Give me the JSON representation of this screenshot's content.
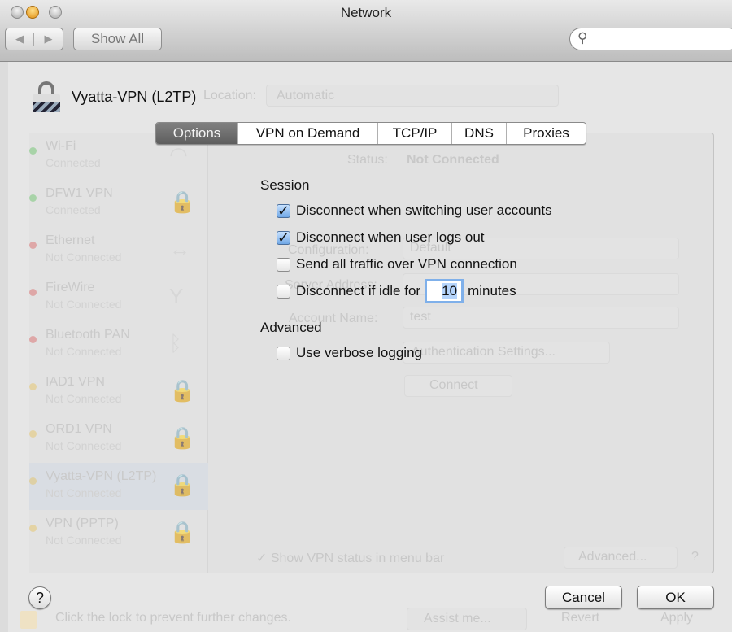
{
  "window": {
    "title": "Network",
    "back_icon": "chevron-left-icon",
    "forward_icon": "chevron-right-icon",
    "show_all": "Show All",
    "search_placeholder": ""
  },
  "background": {
    "service_title": "Vyatta-VPN (L2TP)",
    "location_label": "Location:",
    "location_value": "Automatic",
    "services": [
      {
        "name": "Wi-Fi",
        "status": "Connected",
        "status_color": "#3cb83c",
        "icon": "wifi-icon"
      },
      {
        "name": "DFW1 VPN",
        "status": "Connected",
        "status_color": "#3cb83c",
        "icon": "vpn-lock-icon"
      },
      {
        "name": "Ethernet",
        "status": "Not Connected",
        "status_color": "#d83a3a",
        "icon": "ethernet-icon"
      },
      {
        "name": "FireWire",
        "status": "Not Connected",
        "status_color": "#d83a3a",
        "icon": "firewire-icon"
      },
      {
        "name": "Bluetooth PAN",
        "status": "Not Connected",
        "status_color": "#d83a3a",
        "icon": "bluetooth-icon"
      },
      {
        "name": "IAD1 VPN",
        "status": "Not Connected",
        "status_color": "#e8b830",
        "icon": "vpn-lock-icon"
      },
      {
        "name": "ORD1 VPN",
        "status": "Not Connected",
        "status_color": "#e8b830",
        "icon": "vpn-lock-icon"
      },
      {
        "name": "Vyatta-VPN (L2TP)",
        "status": "Not Connected",
        "status_color": "#e8b830",
        "icon": "vpn-lock-icon"
      },
      {
        "name": "VPN (PPTP)",
        "status": "Not Connected",
        "status_color": "#e8b830",
        "icon": "vpn-lock-icon"
      }
    ],
    "status_label": "Status:",
    "status_value": "Not Connected",
    "configuration_label": "Configuration:",
    "configuration_value": "Default",
    "server_label": "Server Address:",
    "account_label": "Account Name:",
    "account_value": "test",
    "auth_button": "Authentication Settings...",
    "connect_button": "Connect",
    "show_vpn_status": "Show VPN status in menu bar",
    "advanced_button": "Advanced...",
    "lock_text": "Click the lock to prevent further changes.",
    "assist_button": "Assist me...",
    "revert_button": "Revert",
    "apply_button": "Apply"
  },
  "sheet": {
    "tabs": [
      {
        "label": "Options",
        "selected": true
      },
      {
        "label": "VPN on Demand"
      },
      {
        "label": "TCP/IP"
      },
      {
        "label": "DNS"
      },
      {
        "label": "Proxies"
      }
    ],
    "session_heading": "Session",
    "options": [
      {
        "label": "Disconnect when switching user accounts",
        "checked": true
      },
      {
        "label": "Disconnect when user logs out",
        "checked": true
      },
      {
        "label": "Send all traffic over VPN connection",
        "checked": false
      },
      {
        "label": "Disconnect if idle for",
        "checked": false,
        "value": "10",
        "suffix": "minutes"
      }
    ],
    "advanced_heading": "Advanced",
    "verbose": {
      "label": "Use verbose logging",
      "checked": false
    },
    "help": "?",
    "cancel": "Cancel",
    "ok": "OK"
  }
}
